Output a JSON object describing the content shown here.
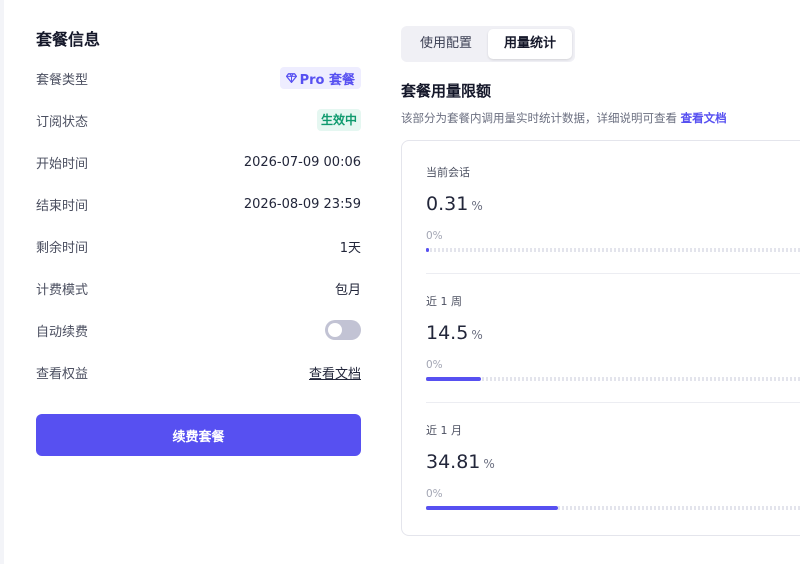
{
  "plan_info": {
    "title": "套餐信息",
    "rows": [
      {
        "label": "套餐类型",
        "value": "Pro 套餐",
        "icon": "diamond-icon"
      },
      {
        "label": "订阅状态",
        "value": "生效中"
      },
      {
        "label": "开始时间",
        "value": "2026-07-09 00:06"
      },
      {
        "label": "结束时间",
        "value": "2026-08-09 23:59"
      },
      {
        "label": "剩余时间",
        "value": "1天"
      },
      {
        "label": "计费模式",
        "value": "包月"
      },
      {
        "label": "自动续费",
        "toggle_on": false
      },
      {
        "label": "查看权益",
        "value": "查看文档"
      }
    ],
    "renew_button": "续费套餐"
  },
  "tabs": [
    {
      "label": "使用配置",
      "active": false
    },
    {
      "label": "用量统计",
      "active": true
    }
  ],
  "usage": {
    "title": "套餐用量限额",
    "description": "该部分为套餐内调用量实时统计数据，详细说明可查看",
    "doc_link": "查看文档",
    "items": [
      {
        "label": "当前会话",
        "value": "0.31",
        "unit": "%",
        "min_label": "0%",
        "percent": 0.31
      },
      {
        "label": "近 1 周",
        "value": "14.5",
        "unit": "%",
        "min_label": "0%",
        "percent": 14.5
      },
      {
        "label": "近 1 月",
        "value": "34.81",
        "unit": "%",
        "min_label": "0%",
        "percent": 34.81
      }
    ]
  },
  "colors": {
    "accent": "#5750f1",
    "success": "#0f9a6e",
    "toggle_off": "#c2c3d4"
  }
}
